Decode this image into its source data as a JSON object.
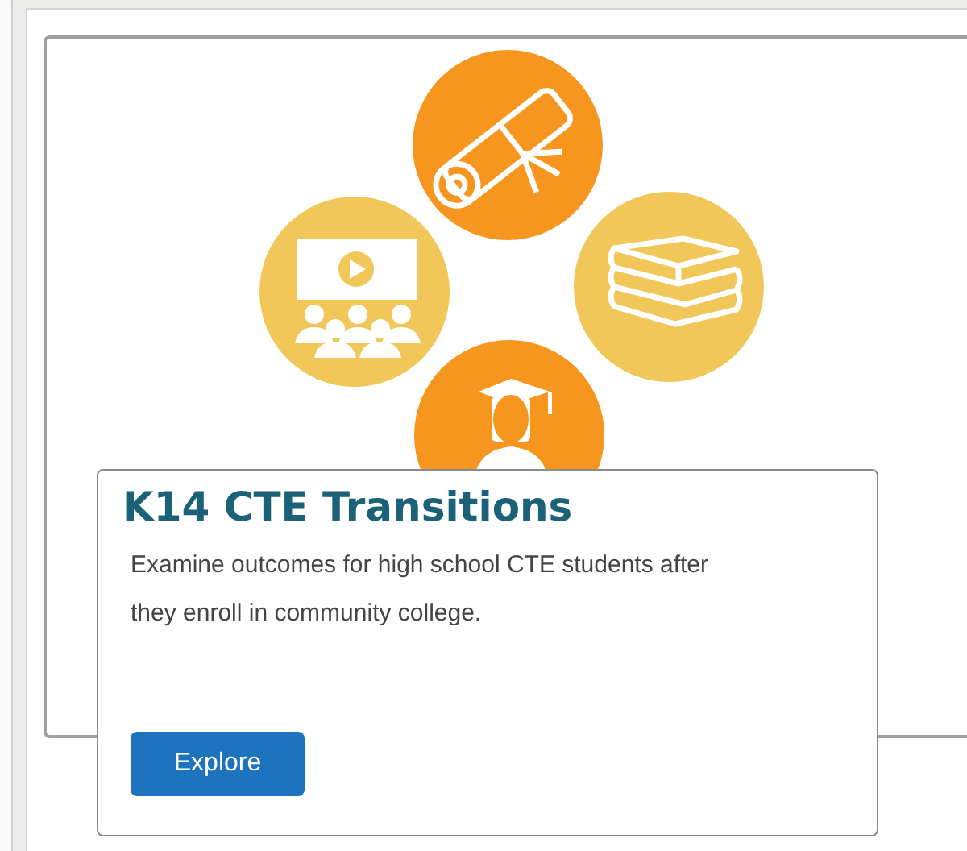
{
  "card": {
    "title": "K14 CTE Transitions",
    "description": "Examine outcomes for high school CTE students after they enroll in community college.",
    "button": "Explore"
  }
}
